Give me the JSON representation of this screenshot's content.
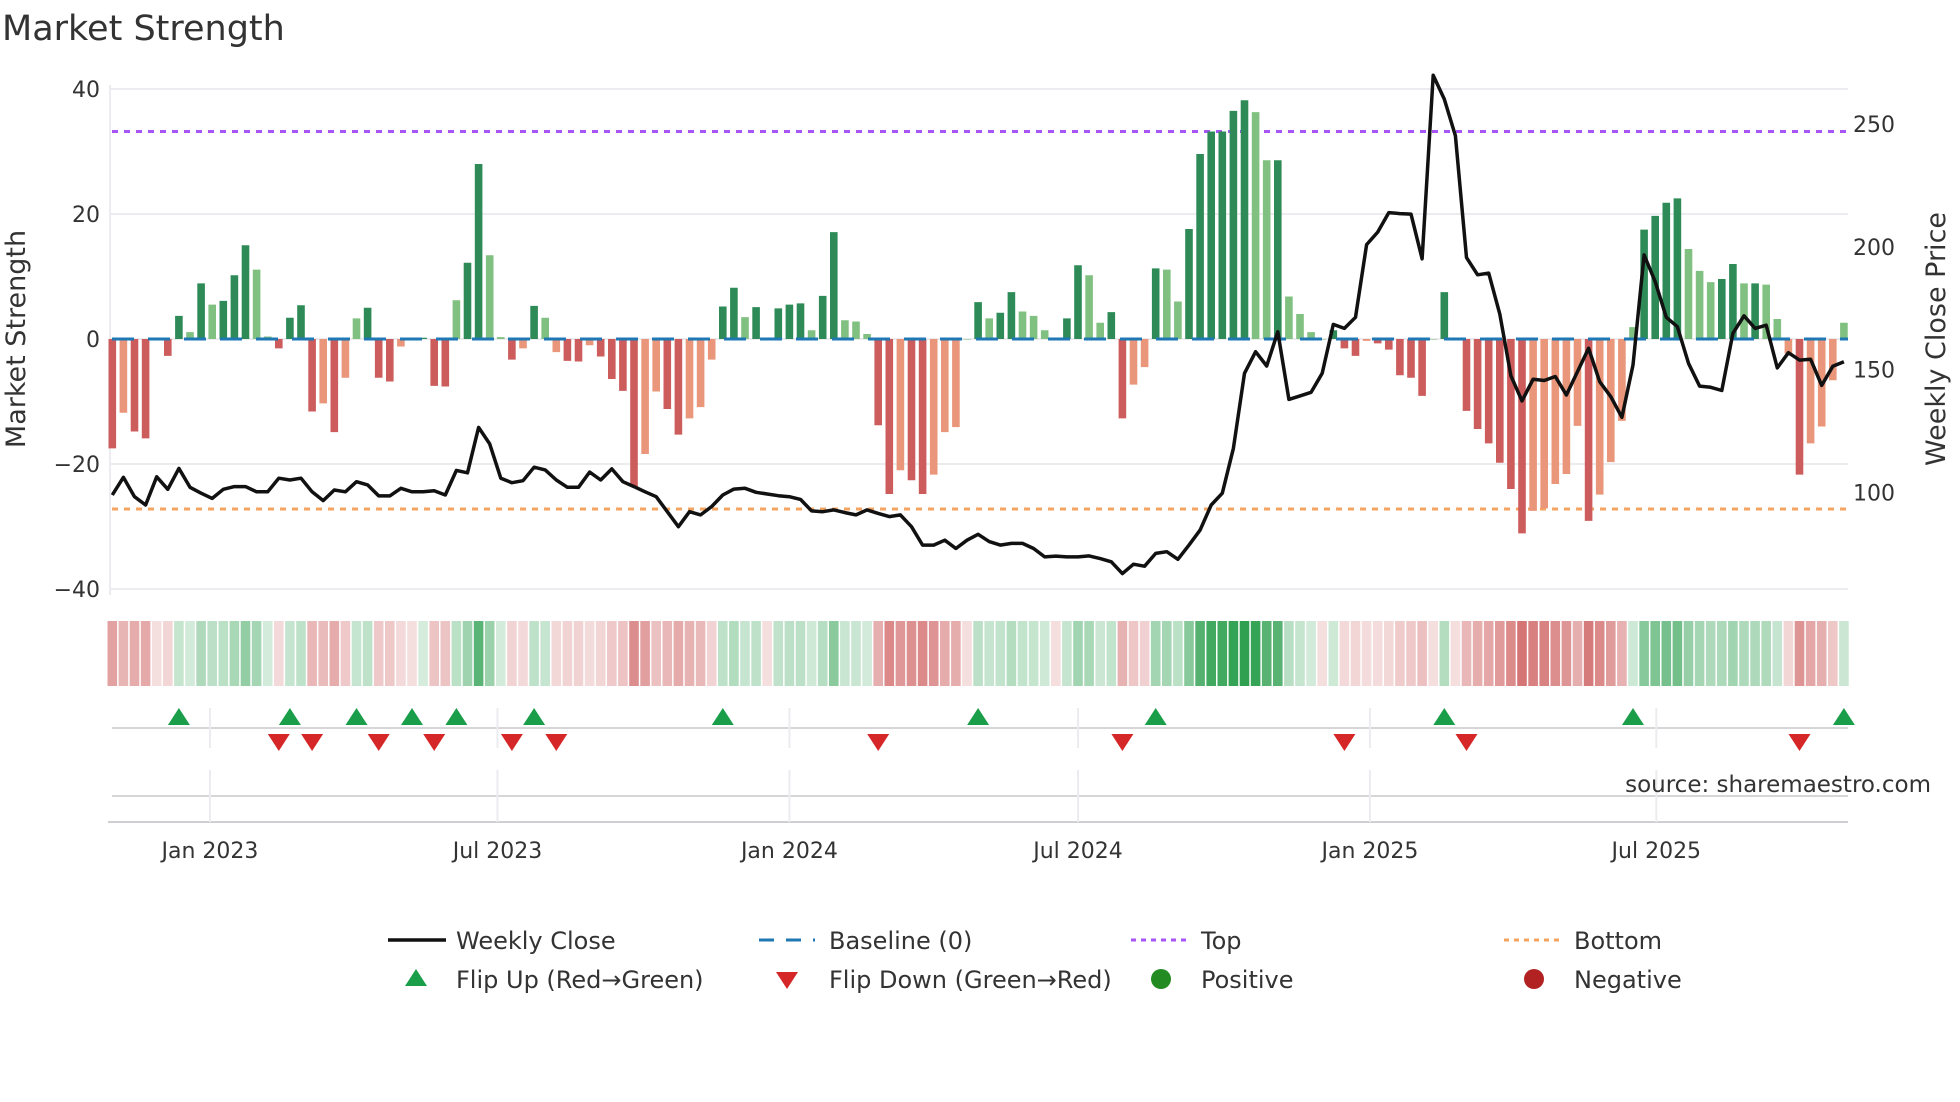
{
  "title": "Market Strength",
  "source": "source: sharemaestro.com",
  "colors": {
    "bar_pos_strong": "#2e8b57",
    "bar_pos_weak": "#80c080",
    "bar_neg_strong": "#cd5c5c",
    "bar_neg_weak": "#e9967a",
    "close_line": "#111111",
    "baseline": "#1f77b4",
    "top": "#a855f7",
    "bottom": "#f4a460",
    "flip_up": "#1a9e4a",
    "flip_down": "#d62728",
    "positive": "#228b22",
    "negative": "#b22222"
  },
  "legend": {
    "weekly_close": "Weekly Close",
    "baseline": "Baseline (0)",
    "top": "Top",
    "bottom": "Bottom",
    "flip_up": "Flip Up (Red→Green)",
    "flip_down": "Flip Down (Green→Red)",
    "positive": "Positive",
    "negative": "Negative"
  },
  "chart_data": {
    "type": "bar",
    "title": "Market Strength",
    "ylabel": "Market Strength",
    "y2label": "Weekly Close Price",
    "ylim": [
      -40,
      40
    ],
    "y2lim": [
      50,
      270
    ],
    "yticks": [
      "40",
      "20",
      "0",
      "−20",
      "−40"
    ],
    "ytick_values": [
      40,
      20,
      0,
      -20,
      -40
    ],
    "y2ticks": [
      "250",
      "200",
      "150",
      "100"
    ],
    "y2tick_values": [
      250,
      200,
      150,
      100
    ],
    "xticks": [
      {
        "label": "Jan 2023",
        "week": 8.8
      },
      {
        "label": "Jul 2023",
        "week": 34.7
      },
      {
        "label": "Jan 2024",
        "week": 61.0
      },
      {
        "label": "Jul 2024",
        "week": 87.0
      },
      {
        "label": "Jan 2025",
        "week": 113.3
      },
      {
        "label": "Jul 2025",
        "week": 139.1
      }
    ],
    "top_level": 33.2,
    "bottom_level": -27.2,
    "baseline": 0,
    "strength": [
      -17.5,
      -11.8,
      -14.8,
      -15.9,
      0,
      -2.7,
      3.7,
      1.1,
      8.9,
      5.5,
      6.1,
      10.2,
      15,
      11.1,
      0.4,
      -1.5,
      3.4,
      5.4,
      -11.6,
      -10.3,
      -14.9,
      -6.2,
      3.3,
      5.0,
      -6.2,
      -6.8,
      -1.2,
      0,
      0.2,
      -7.5,
      -7.6,
      6.2,
      12.2,
      28,
      13.4,
      0.3,
      -3.3,
      -1.5,
      5.3,
      3.4,
      -2.1,
      -3.5,
      -3.6,
      -1,
      -2.8,
      -6.4,
      -8.3,
      -23.6,
      -18.4,
      -8.4,
      -11.2,
      -15.3,
      -12.7,
      -10.9,
      -3.3,
      5.2,
      8.2,
      3.5,
      5.1,
      0,
      4.9,
      5.5,
      5.7,
      1.4,
      6.9,
      17.1,
      3.0,
      2.8,
      0.8,
      -13.8,
      -24.8,
      -21,
      -22.6,
      -24.8,
      -21.7,
      -14.9,
      -14.1,
      0,
      5.9,
      3.3,
      4.2,
      7.5,
      4.4,
      3.7,
      1.4,
      0,
      3.3,
      11.8,
      10.2,
      2.6,
      4.3,
      -12.7,
      -7.3,
      -4.5,
      11.3,
      11.1,
      6.0,
      17.6,
      29.6,
      33.2,
      33.2,
      36.5,
      38.2,
      36.3,
      28.6,
      28.6,
      6.8,
      4.0,
      1.1,
      0,
      1.4,
      -1.5,
      -2.7,
      -0.3,
      -0.7,
      -1.7,
      -5.8,
      -6.2,
      -9.1,
      0,
      7.5,
      0,
      -11.5,
      -14.4,
      -16.7,
      -19.8,
      -24,
      -31.1,
      -27.5,
      -27.1,
      -23.2,
      -21.6,
      -13.9,
      -29.1,
      -24.9,
      -19.7,
      -13.1,
      1.9,
      17.5,
      19.7,
      21.8,
      22.5,
      14.4,
      10.9,
      9.1,
      9.6,
      12,
      8.9,
      8.9,
      8.7,
      3.2,
      -2.3,
      -21.7,
      -16.7,
      -14,
      -6.6,
      2.6
    ],
    "weekly_close": [
      99.0,
      106.2,
      98.3,
      94.9,
      106.4,
      101.3,
      109.8,
      102.1,
      99.7,
      97.6,
      101.3,
      102.4,
      102.4,
      100.3,
      100.3,
      105.8,
      105.1,
      105.8,
      100.3,
      96.7,
      101,
      100.3,
      104.4,
      103.1,
      98.6,
      98.6,
      101.7,
      100.3,
      100.3,
      100.7,
      99,
      109,
      108,
      126.5,
      119.8,
      105.8,
      104,
      104.8,
      110.3,
      109.2,
      105.1,
      102.1,
      102.1,
      108.3,
      105.1,
      109.6,
      104.4,
      102.4,
      100.3,
      98.3,
      92.2,
      86.1,
      92.2,
      90.9,
      94.3,
      99,
      101.4,
      101.7,
      100.1,
      99.4,
      98.7,
      98.3,
      97.2,
      92.5,
      92.2,
      92.9,
      91.8,
      90.9,
      92.9,
      91.5,
      90.2,
      90.9,
      86.1,
      78.6,
      78.6,
      80.6,
      77.2,
      80.6,
      83.0,
      80,
      78.6,
      79.3,
      79.3,
      77.2,
      73.8,
      74.1,
      73.8,
      73.8,
      74.2,
      73.1,
      71.8,
      67,
      70.8,
      70,
      75.2,
      75.9,
      72.8,
      78.6,
      84.7,
      94.9,
      99.7,
      118,
      148.5,
      157.3,
      151.5,
      165.4,
      137.9,
      139.3,
      140.8,
      148.5,
      168.4,
      166.8,
      171.3,
      200.9,
      206,
      213.9,
      213.5,
      213.3,
      195.1,
      269.8,
      260.1,
      245.2,
      195.6,
      188.6,
      189.3,
      172.6,
      147.5,
      137.3,
      146.1,
      145.6,
      147.2,
      139.7,
      149.2,
      158.7,
      145.1,
      139,
      130.6,
      151.9,
      196.7,
      185.8,
      171.3,
      167.5,
      152.6,
      143.3,
      142.8,
      141.5,
      164.8,
      171.9,
      166.8,
      168.1,
      150.7,
      156.9,
      153.9,
      154.2,
      143.6,
      151.4,
      153.2
    ],
    "flip_up_weeks": [
      6,
      16,
      22,
      27,
      31,
      38,
      55,
      78,
      94,
      120,
      137,
      156
    ],
    "flip_down_weeks": [
      15,
      18,
      24,
      29,
      36,
      40,
      69,
      91,
      111,
      122,
      152
    ],
    "legend_position": "bottom"
  }
}
